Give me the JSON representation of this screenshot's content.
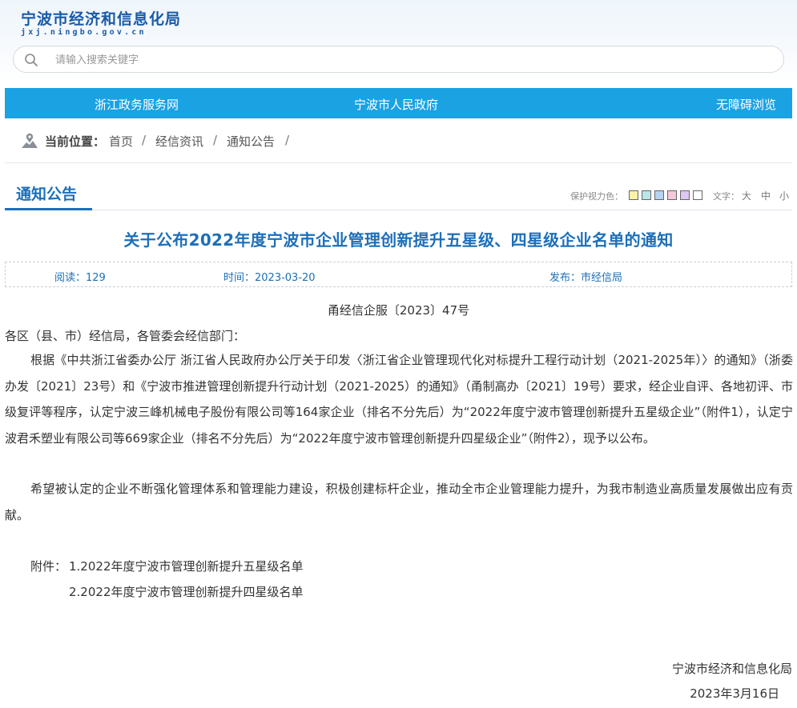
{
  "site": {
    "title": "宁波市经济和信息化局",
    "url": "jxj.ningbo.gov.cn"
  },
  "search": {
    "placeholder": "请输入搜索关键字"
  },
  "nav": {
    "links": [
      "浙江政务服务网",
      "宁波市人民政府",
      "无障碍浏览"
    ]
  },
  "breadcrumb": {
    "label": "当前位置：",
    "items": [
      "首页",
      "经信资讯",
      "通知公告"
    ],
    "separator": "/"
  },
  "section": {
    "title": "通知公告"
  },
  "tools": {
    "eye_label": "保护视力色：",
    "eye_colors": [
      "#faf3a8",
      "#b9e6e8",
      "#b5d3f1",
      "#f4c9dc",
      "#dcc8f2",
      "#ffffff"
    ],
    "font_label": "文字：",
    "font_sizes": [
      "大",
      "中",
      "小"
    ]
  },
  "article": {
    "title": "关于公布2022年度宁波市企业管理创新提升五星级、四星级企业名单的通知",
    "meta": {
      "reads": "阅读：129",
      "time": "时间：2023-03-20",
      "publisher": "发布：市经信局"
    },
    "doc_number": "甬经信企服〔2023〕47号",
    "salutation": "各区（县、市）经信局，各管委会经信部门：",
    "paragraph1": "根据《中共浙江省委办公厅 浙江省人民政府办公厅关于印发〈浙江省企业管理现代化对标提升工程行动计划（2021-2025年）〉的通知》（浙委办发〔2021〕23号）和《宁波市推进管理创新提升行动计划（2021-2025）的通知》（甬制高办〔2021〕19号）要求，经企业自评、各地初评、市级复评等程序，认定宁波三峰机械电子股份有限公司等164家企业（排名不分先后）为“2022年度宁波市管理创新提升五星级企业”（附件1），认定宁波君禾塑业有限公司等669家企业（排名不分先后）为“2022年度宁波市管理创新提升四星级企业”（附件2），现予以公布。",
    "paragraph2": "希望被认定的企业不断强化管理体系和管理能力建设，积极创建标杆企业，推动全市企业管理能力提升，为我市制造业高质量发展做出应有贡献。",
    "attachments_label": "附件：",
    "attachments": [
      "1.2022年度宁波市管理创新提升五星级名单",
      "2.2022年度宁波市管理创新提升四星级名单"
    ],
    "signature": "宁波市经济和信息化局",
    "date": "2023年3月16日"
  }
}
